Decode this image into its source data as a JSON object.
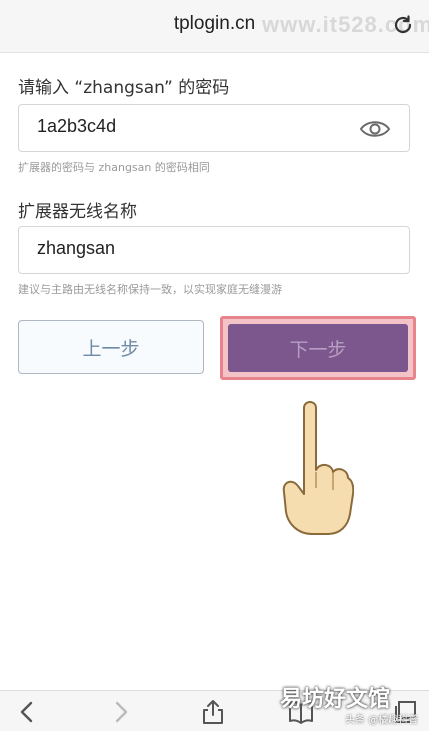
{
  "browser": {
    "url": "tplogin.cn",
    "watermark": "www.it528.com"
  },
  "form": {
    "password_label": "请输入 “zhangsan” 的密码",
    "password_value": "1a2b3c4d",
    "password_hint": "扩展器的密码与 zhangsan 的密码相同",
    "ssid_label": "扩展器无线名称",
    "ssid_value": "zhangsan",
    "ssid_hint": "建议与主路由无线名称保持一致，以实现家庭无缝漫游"
  },
  "buttons": {
    "prev_label": "上一步",
    "next_label": "下一步"
  },
  "colors": {
    "next_button": "#7b578d",
    "highlight": "#e8848c",
    "prev_text": "#6f8aa6"
  },
  "watermarks": {
    "brand": "易坊好文馆",
    "small": "头条 @橘趣科普"
  }
}
